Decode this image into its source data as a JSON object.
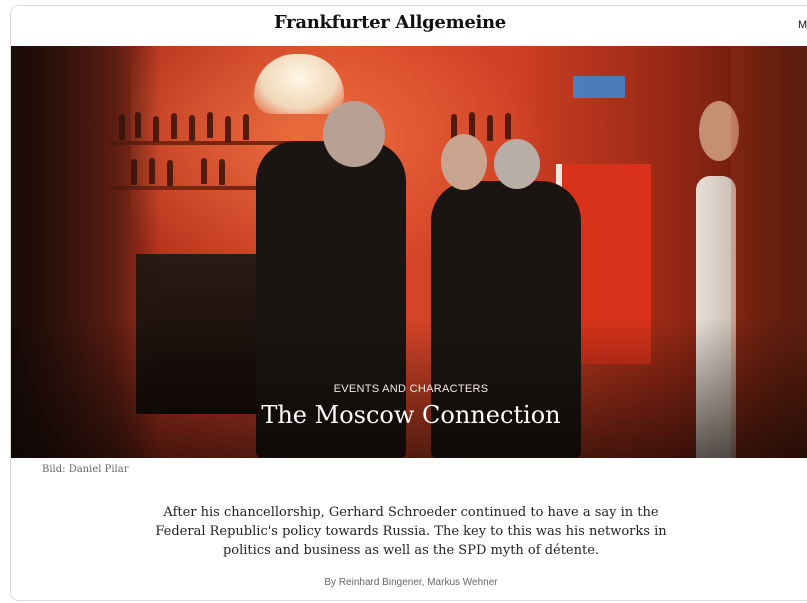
{
  "header": {
    "logo_text": "Frankfurter Allgemeine",
    "menu_label": "M"
  },
  "article": {
    "kicker": "EVENTS AND CHARACTERS",
    "title": "The Moscow Connection",
    "image_credit": "Bild: Daniel Pilar",
    "teaser": "After his chancellorship, Gerhard Schroeder continued to have a say in the Federal Republic's policy towards Russia. The key to this was his networks in politics and business as well as the SPD myth of détente.",
    "byline": "By Reinhard Bingener, Markus Wehner"
  },
  "colors": {
    "accent_red": "#d9482a",
    "text_dark": "#222222",
    "text_muted": "#666666"
  }
}
